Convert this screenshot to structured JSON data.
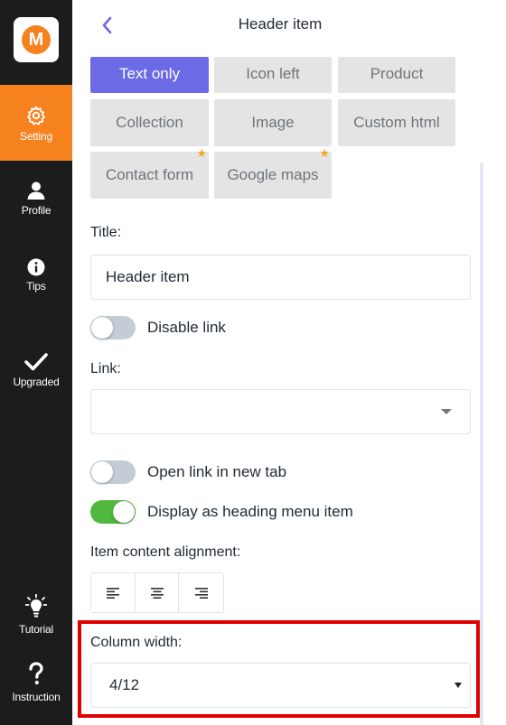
{
  "sidebar": {
    "logo_letter": "M",
    "items": [
      {
        "label": "Setting",
        "icon": "gear-icon",
        "active": true
      },
      {
        "label": "Profile",
        "icon": "user-icon"
      },
      {
        "label": "Tips",
        "icon": "info-icon"
      },
      {
        "label": "Upgraded",
        "icon": "checkmark-icon"
      },
      {
        "label": "Tutorial",
        "icon": "lightbulb-icon"
      },
      {
        "label": "Instruction",
        "icon": "question-icon"
      }
    ],
    "accent_color": "#f5821f",
    "background_color": "#1c1c1c"
  },
  "header": {
    "title": "Header item",
    "back_icon": "chevron-left-icon"
  },
  "item_types": [
    {
      "label": "Text only",
      "active": true,
      "premium": false
    },
    {
      "label": "Icon left",
      "active": false,
      "premium": false
    },
    {
      "label": "Product",
      "active": false,
      "premium": false
    },
    {
      "label": "Collection",
      "active": false,
      "premium": false
    },
    {
      "label": "Image",
      "active": false,
      "premium": false
    },
    {
      "label": "Custom html",
      "active": false,
      "premium": false
    },
    {
      "label": "Contact form",
      "active": false,
      "premium": true
    },
    {
      "label": "Google maps",
      "active": false,
      "premium": true
    }
  ],
  "form": {
    "title_label": "Title:",
    "title_value": "Header item",
    "disable_link_label": "Disable link",
    "disable_link_on": false,
    "link_label": "Link:",
    "link_value": "",
    "open_new_tab_label": "Open link in new tab",
    "open_new_tab_on": false,
    "display_heading_label": "Display as heading menu item",
    "display_heading_on": true,
    "alignment_label": "Item content alignment:",
    "alignment_options": [
      "align-left-icon",
      "align-center-icon",
      "align-right-icon"
    ],
    "column_width_label": "Column width:",
    "column_width_value": "4/12"
  },
  "colors": {
    "primary": "#6c6ae4",
    "toggle_on": "#50b83c",
    "highlight": "#e00000",
    "premium_star": "#f5a623"
  }
}
